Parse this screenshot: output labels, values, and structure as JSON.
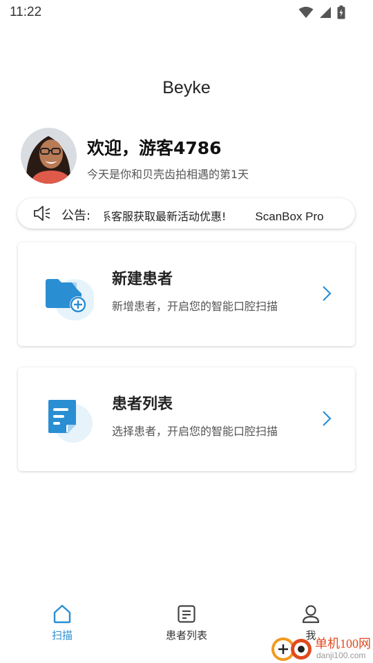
{
  "status_bar": {
    "time": "11:22"
  },
  "app": {
    "title": "Beyke"
  },
  "welcome": {
    "title": "欢迎，游客4786",
    "subtitle": "今天是你和贝壳齿拍相遇的第1天"
  },
  "notice": {
    "label": "公告:",
    "text": "系客服获取最新活动优惠!",
    "text2": "ScanBox Pro"
  },
  "cards": [
    {
      "title": "新建患者",
      "subtitle": "新增患者，开启您的智能口腔扫描",
      "icon": "new-folder-icon"
    },
    {
      "title": "患者列表",
      "subtitle": "选择患者，开启您的智能口腔扫描",
      "icon": "document-list-icon"
    }
  ],
  "tabbar": {
    "tabs": [
      {
        "label": "扫描",
        "icon": "home-icon",
        "active": true
      },
      {
        "label": "患者列表",
        "icon": "list-icon",
        "active": false
      },
      {
        "label": "我",
        "icon": "user-icon",
        "active": false
      }
    ]
  },
  "colors": {
    "accent": "#2a8ed3",
    "icon_bg": "#e6f3fb"
  },
  "watermark": {
    "name": "单机100网",
    "url": "danji100.com"
  }
}
